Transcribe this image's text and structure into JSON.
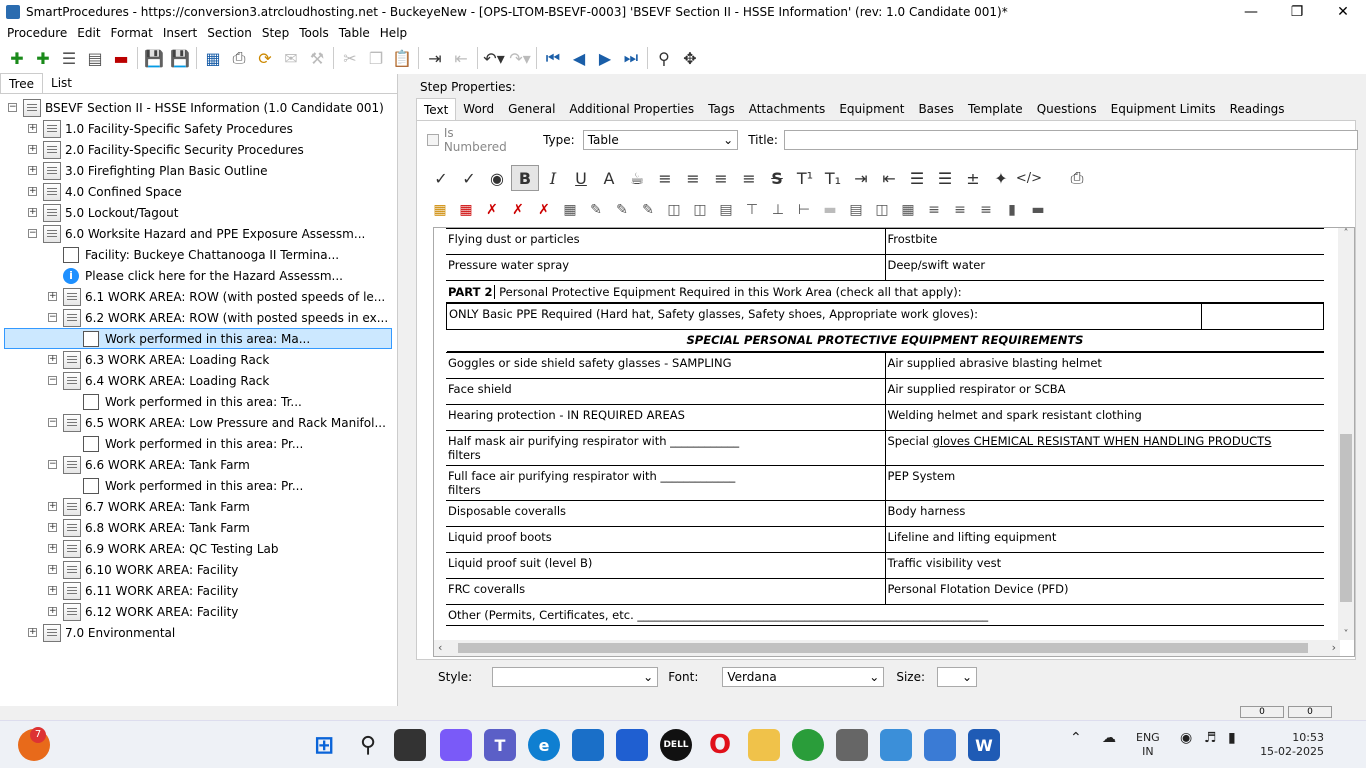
{
  "window": {
    "title": "SmartProcedures - https://conversion3.atrcloudhosting.net - BuckeyeNew - [OPS-LTOM-BSEVF-0003] 'BSEVF Section II - HSSE Information' (rev: 1.0 Candidate 001)*"
  },
  "menu": [
    "Procedure",
    "Edit",
    "Format",
    "Insert",
    "Section",
    "Step",
    "Tools",
    "Table",
    "Help"
  ],
  "left_tabs": [
    "Tree",
    "List"
  ],
  "tree": [
    {
      "label": "BSEVF Section II - HSSE Information (1.0 Candidate 001)",
      "level": 0,
      "exp": "-",
      "icon": "doc"
    },
    {
      "label": "1.0 Facility-Specific Safety Procedures",
      "level": 1,
      "exp": "+",
      "icon": "doc"
    },
    {
      "label": "2.0 Facility-Specific Security Procedures",
      "level": 1,
      "exp": "+",
      "icon": "doc"
    },
    {
      "label": "3.0 Firefighting Plan Basic Outline",
      "level": 1,
      "exp": "+",
      "icon": "doc"
    },
    {
      "label": "4.0 Confined Space",
      "level": 1,
      "exp": "+",
      "icon": "doc"
    },
    {
      "label": "5.0 Lockout/Tagout",
      "level": 1,
      "exp": "+",
      "icon": "doc"
    },
    {
      "label": "6.0 Worksite Hazard and PPE Exposure Assessm...",
      "level": 1,
      "exp": "-",
      "icon": "doc"
    },
    {
      "label": "Facility: Buckeye Chattanooga II Termina...",
      "level": 2,
      "exp": "",
      "icon": "step"
    },
    {
      "label": "Please click here for the Hazard Assessm...",
      "level": 2,
      "exp": "",
      "icon": "info"
    },
    {
      "label": "6.1 WORK AREA: ROW (with posted speeds of le...",
      "level": 2,
      "exp": "+",
      "icon": "doc"
    },
    {
      "label": "6.2 WORK AREA: ROW (with posted speeds in ex...",
      "level": 2,
      "exp": "-",
      "icon": "doc"
    },
    {
      "label": "Work performed in this area:          Ma...",
      "level": 3,
      "exp": "",
      "icon": "step",
      "selected": true
    },
    {
      "label": "6.3 WORK AREA: Loading Rack",
      "level": 2,
      "exp": "+",
      "icon": "doc"
    },
    {
      "label": "6.4 WORK AREA: Loading Rack",
      "level": 2,
      "exp": "-",
      "icon": "doc"
    },
    {
      "label": "Work performed in this area:          Tr...",
      "level": 3,
      "exp": "",
      "icon": "step"
    },
    {
      "label": "6.5 WORK AREA: Low Pressure and Rack Manifol...",
      "level": 2,
      "exp": "-",
      "icon": "doc"
    },
    {
      "label": "Work performed in this area:          Pr...",
      "level": 3,
      "exp": "",
      "icon": "step"
    },
    {
      "label": "6.6 WORK AREA: Tank Farm",
      "level": 2,
      "exp": "-",
      "icon": "doc"
    },
    {
      "label": "Work performed in this area:          Pr...",
      "level": 3,
      "exp": "",
      "icon": "step"
    },
    {
      "label": "6.7 WORK AREA: Tank Farm",
      "level": 2,
      "exp": "+",
      "icon": "doc"
    },
    {
      "label": "6.8 WORK AREA: Tank Farm",
      "level": 2,
      "exp": "+",
      "icon": "doc"
    },
    {
      "label": "6.9 WORK AREA: QC Testing Lab",
      "level": 2,
      "exp": "+",
      "icon": "doc"
    },
    {
      "label": "6.10 WORK AREA: Facility",
      "level": 2,
      "exp": "+",
      "icon": "doc"
    },
    {
      "label": "6.11 WORK AREA: Facility",
      "level": 2,
      "exp": "+",
      "icon": "doc"
    },
    {
      "label": "6.12 WORK AREA: Facility",
      "level": 2,
      "exp": "+",
      "icon": "doc"
    },
    {
      "label": "7.0 Environmental",
      "level": 1,
      "exp": "+",
      "icon": "doc"
    }
  ],
  "right": {
    "step_properties": "Step Properties:",
    "tabs": [
      "Text",
      "Word",
      "General",
      "Additional Properties",
      "Tags",
      "Attachments",
      "Equipment",
      "Bases",
      "Template",
      "Questions",
      "Equipment Limits",
      "Readings"
    ],
    "is_numbered": "Is Numbered",
    "type_label": "Type:",
    "type_value": "Table",
    "title_label": "Title:",
    "style_label": "Style:",
    "font_label": "Font:",
    "font_value": "Verdana",
    "size_label": "Size:"
  },
  "doc": {
    "top_rows": [
      [
        "Flying dust or particles",
        "Frostbite"
      ],
      [
        "Pressure water spray",
        "Deep/swift water"
      ]
    ],
    "part2_bold": "PART 2",
    "part2_rest": " Personal Protective Equipment Required in this Work Area (check all that apply):",
    "basic_ppe": "ONLY Basic PPE Required (Hard hat, Safety glasses, Safety shoes, Appropriate work gloves):",
    "special_header": "SPECIAL PERSONAL PROTECTIVE EQUIPMENT REQUIREMENTS",
    "row_goggles": [
      "Goggles or side shield safety glasses - SAMPLING",
      "Air supplied abrasive blasting helmet"
    ],
    "row_face": [
      "Face shield",
      "Air supplied respirator or SCBA"
    ],
    "row_hearing": [
      "Hearing protection - IN REQUIRED AREAS",
      "Welding helmet and spark resistant clothing"
    ],
    "half_mask": "Half mask air purifying respirator with ____________ filters",
    "special_gloves_prefix": "Special ",
    "special_gloves_underlined": "gloves  CHEMICAL RESISTANT WHEN HANDLING PRODUCTS",
    "row_fullface": [
      "Full face air purifying respirator with _____________ filters",
      "PEP System"
    ],
    "row_coveralls": [
      "Disposable coveralls",
      "Body harness"
    ],
    "row_boots": [
      "Liquid proof boots",
      "Lifeline and lifting equipment"
    ],
    "row_suit": [
      "Liquid proof suit (level B)",
      "Traffic visibility vest"
    ],
    "row_frc": [
      "FRC coveralls",
      "Personal Flotation Device (PFD)"
    ],
    "other": "Other (Permits, Certificates, etc. _____________________________________________________________"
  },
  "status": {
    "box1": "0",
    "box2": "0"
  },
  "taskbar": {
    "badge": "7",
    "lang1": "ENG",
    "lang2": "IN",
    "time": "10:53",
    "date": "15-02-2025"
  }
}
